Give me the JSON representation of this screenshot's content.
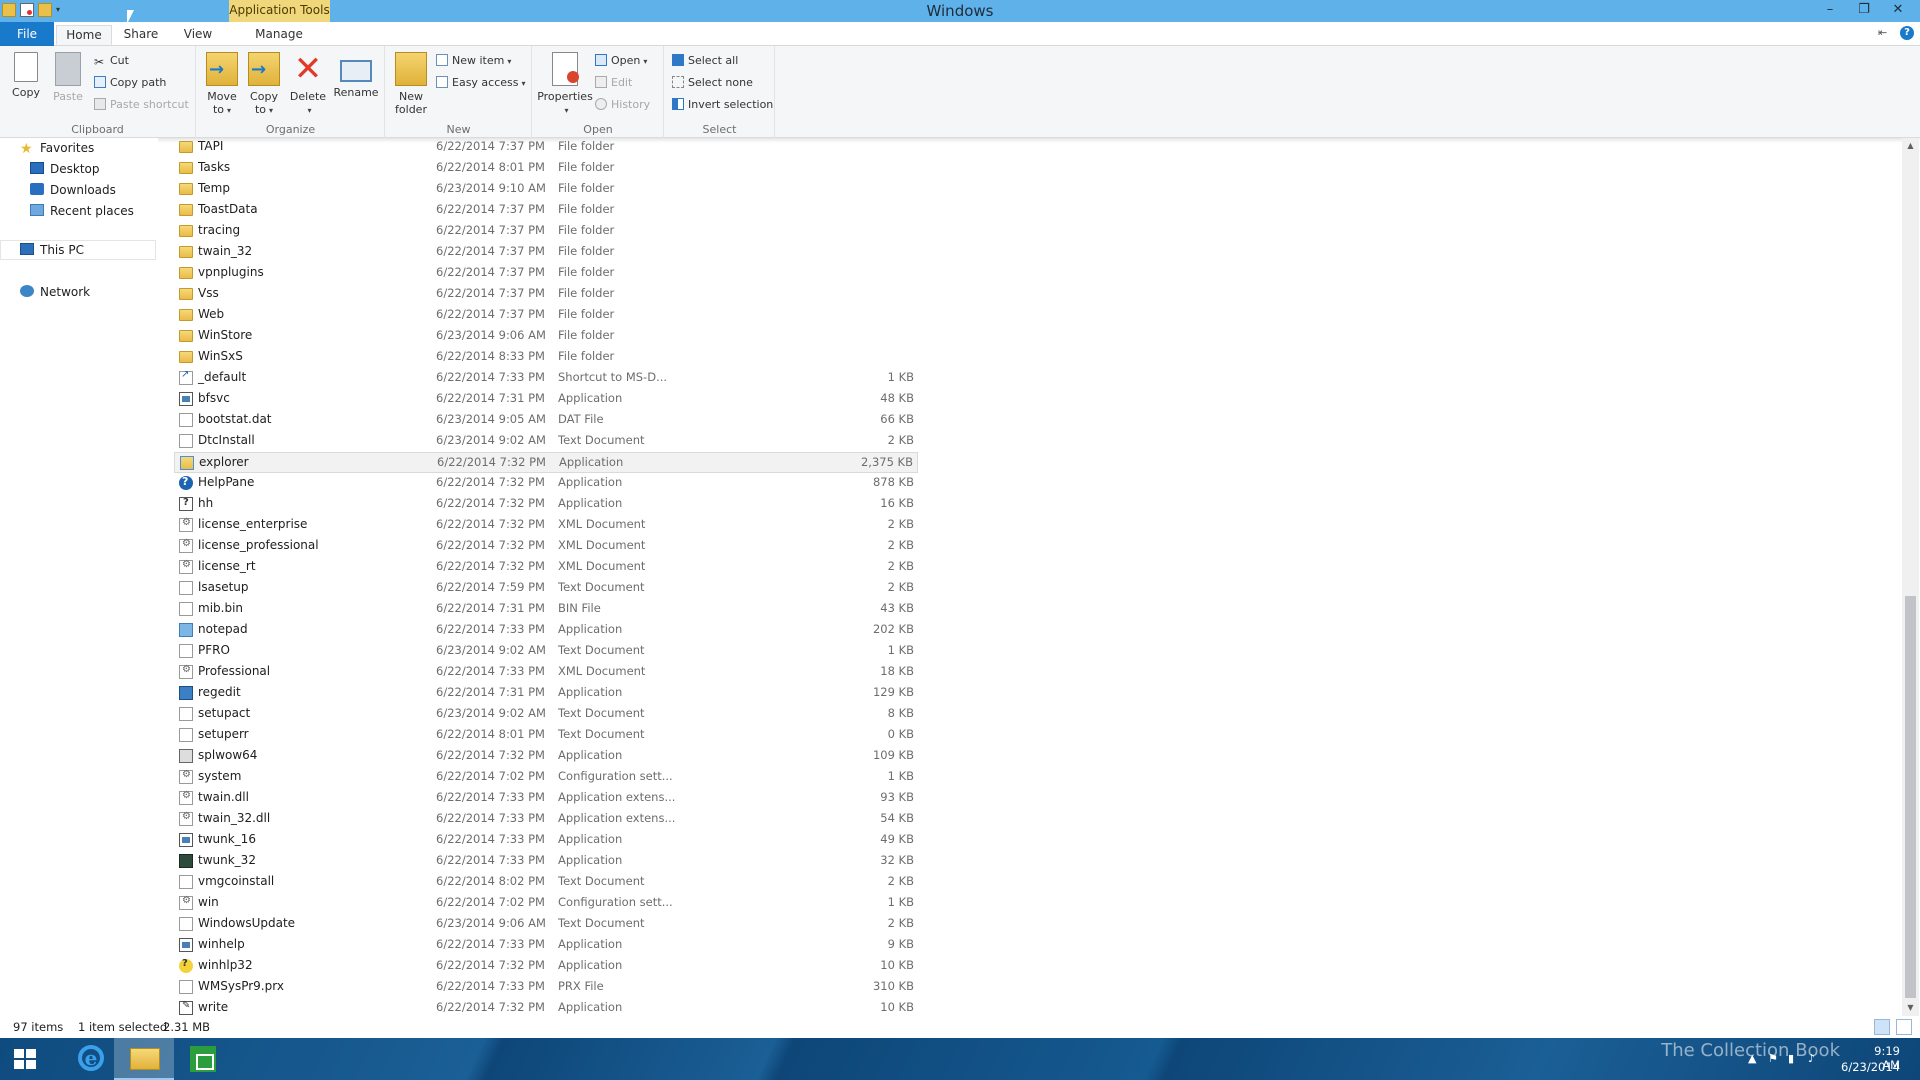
{
  "window": {
    "title": "Windows",
    "contextual_tab": "Application Tools",
    "controls": {
      "minimize": "–",
      "restore": "❐",
      "close": "✕"
    }
  },
  "ribbon_tabs": {
    "file": "File",
    "home": "Home",
    "share": "Share",
    "view": "View",
    "manage": "Manage"
  },
  "ribbon": {
    "clipboard": {
      "label": "Clipboard",
      "copy": "Copy",
      "paste": "Paste",
      "cut": "Cut",
      "copy_path": "Copy path",
      "paste_shortcut": "Paste shortcut"
    },
    "organize": {
      "label": "Organize",
      "move_to_line1": "Move",
      "move_to_line2": "to",
      "copy_to_line1": "Copy",
      "copy_to_line2": "to",
      "delete": "Delete",
      "rename": "Rename"
    },
    "new": {
      "label": "New",
      "new_folder_line1": "New",
      "new_folder_line2": "folder",
      "new_item": "New item",
      "easy_access": "Easy access"
    },
    "open": {
      "label": "Open",
      "properties": "Properties",
      "open": "Open",
      "edit": "Edit",
      "history": "History"
    },
    "select": {
      "label": "Select",
      "select_all": "Select all",
      "select_none": "Select none",
      "invert_selection": "Invert selection"
    }
  },
  "nav": {
    "favorites": "Favorites",
    "desktop": "Desktop",
    "downloads": "Downloads",
    "recent_places": "Recent places",
    "this_pc": "This PC",
    "network": "Network"
  },
  "files": [
    {
      "name": "TAPI",
      "date": "6/22/2014 7:37 PM",
      "type": "File folder",
      "size": "",
      "icon": "folder"
    },
    {
      "name": "Tasks",
      "date": "6/22/2014 8:01 PM",
      "type": "File folder",
      "size": "",
      "icon": "folder"
    },
    {
      "name": "Temp",
      "date": "6/23/2014 9:10 AM",
      "type": "File folder",
      "size": "",
      "icon": "folder"
    },
    {
      "name": "ToastData",
      "date": "6/22/2014 7:37 PM",
      "type": "File folder",
      "size": "",
      "icon": "folder"
    },
    {
      "name": "tracing",
      "date": "6/22/2014 7:37 PM",
      "type": "File folder",
      "size": "",
      "icon": "folder"
    },
    {
      "name": "twain_32",
      "date": "6/22/2014 7:37 PM",
      "type": "File folder",
      "size": "",
      "icon": "folder"
    },
    {
      "name": "vpnplugins",
      "date": "6/22/2014 7:37 PM",
      "type": "File folder",
      "size": "",
      "icon": "folder"
    },
    {
      "name": "Vss",
      "date": "6/22/2014 7:37 PM",
      "type": "File folder",
      "size": "",
      "icon": "folder"
    },
    {
      "name": "Web",
      "date": "6/22/2014 7:37 PM",
      "type": "File folder",
      "size": "",
      "icon": "folder"
    },
    {
      "name": "WinStore",
      "date": "6/23/2014 9:06 AM",
      "type": "File folder",
      "size": "",
      "icon": "folder"
    },
    {
      "name": "WinSxS",
      "date": "6/22/2014 8:33 PM",
      "type": "File folder",
      "size": "",
      "icon": "folder"
    },
    {
      "name": "_default",
      "date": "6/22/2014 7:33 PM",
      "type": "Shortcut to MS-D...",
      "size": "1 KB",
      "icon": "shortcut"
    },
    {
      "name": "bfsvc",
      "date": "6/22/2014 7:31 PM",
      "type": "Application",
      "size": "48 KB",
      "icon": "app"
    },
    {
      "name": "bootstat.dat",
      "date": "6/23/2014 9:05 AM",
      "type": "DAT File",
      "size": "66 KB",
      "icon": "doc"
    },
    {
      "name": "DtcInstall",
      "date": "6/23/2014 9:02 AM",
      "type": "Text Document",
      "size": "2 KB",
      "icon": "doc"
    },
    {
      "name": "explorer",
      "date": "6/22/2014 7:32 PM",
      "type": "Application",
      "size": "2,375 KB",
      "icon": "explorer",
      "selected": true
    },
    {
      "name": "HelpPane",
      "date": "6/22/2014 7:32 PM",
      "type": "Application",
      "size": "878 KB",
      "icon": "help"
    },
    {
      "name": "hh",
      "date": "6/22/2014 7:32 PM",
      "type": "Application",
      "size": "16 KB",
      "icon": "hh"
    },
    {
      "name": "license_enterprise",
      "date": "6/22/2014 7:32 PM",
      "type": "XML Document",
      "size": "2 KB",
      "icon": "config"
    },
    {
      "name": "license_professional",
      "date": "6/22/2014 7:32 PM",
      "type": "XML Document",
      "size": "2 KB",
      "icon": "config"
    },
    {
      "name": "license_rt",
      "date": "6/22/2014 7:32 PM",
      "type": "XML Document",
      "size": "2 KB",
      "icon": "config"
    },
    {
      "name": "lsasetup",
      "date": "6/22/2014 7:59 PM",
      "type": "Text Document",
      "size": "2 KB",
      "icon": "doc"
    },
    {
      "name": "mib.bin",
      "date": "6/22/2014 7:31 PM",
      "type": "BIN File",
      "size": "43 KB",
      "icon": "doc"
    },
    {
      "name": "notepad",
      "date": "6/22/2014 7:33 PM",
      "type": "Application",
      "size": "202 KB",
      "icon": "notepad"
    },
    {
      "name": "PFRO",
      "date": "6/23/2014 9:02 AM",
      "type": "Text Document",
      "size": "1 KB",
      "icon": "doc"
    },
    {
      "name": "Professional",
      "date": "6/22/2014 7:33 PM",
      "type": "XML Document",
      "size": "18 KB",
      "icon": "config"
    },
    {
      "name": "regedit",
      "date": "6/22/2014 7:31 PM",
      "type": "Application",
      "size": "129 KB",
      "icon": "regedit"
    },
    {
      "name": "setupact",
      "date": "6/23/2014 9:02 AM",
      "type": "Text Document",
      "size": "8 KB",
      "icon": "doc"
    },
    {
      "name": "setuperr",
      "date": "6/22/2014 8:01 PM",
      "type": "Text Document",
      "size": "0 KB",
      "icon": "doc"
    },
    {
      "name": "splwow64",
      "date": "6/22/2014 7:32 PM",
      "type": "Application",
      "size": "109 KB",
      "icon": "printer"
    },
    {
      "name": "system",
      "date": "6/22/2014 7:02 PM",
      "type": "Configuration sett...",
      "size": "1 KB",
      "icon": "config"
    },
    {
      "name": "twain.dll",
      "date": "6/22/2014 7:33 PM",
      "type": "Application extens...",
      "size": "93 KB",
      "icon": "config"
    },
    {
      "name": "twain_32.dll",
      "date": "6/22/2014 7:33 PM",
      "type": "Application extens...",
      "size": "54 KB",
      "icon": "config"
    },
    {
      "name": "twunk_16",
      "date": "6/22/2014 7:33 PM",
      "type": "Application",
      "size": "49 KB",
      "icon": "app"
    },
    {
      "name": "twunk_32",
      "date": "6/22/2014 7:33 PM",
      "type": "Application",
      "size": "32 KB",
      "icon": "dark"
    },
    {
      "name": "vmgcoinstall",
      "date": "6/22/2014 8:02 PM",
      "type": "Text Document",
      "size": "2 KB",
      "icon": "doc"
    },
    {
      "name": "win",
      "date": "6/22/2014 7:02 PM",
      "type": "Configuration sett...",
      "size": "1 KB",
      "icon": "config"
    },
    {
      "name": "WindowsUpdate",
      "date": "6/23/2014 9:06 AM",
      "type": "Text Document",
      "size": "2 KB",
      "icon": "doc"
    },
    {
      "name": "winhelp",
      "date": "6/22/2014 7:33 PM",
      "type": "Application",
      "size": "9 KB",
      "icon": "app"
    },
    {
      "name": "winhlp32",
      "date": "6/22/2014 7:32 PM",
      "type": "Application",
      "size": "10 KB",
      "icon": "winhlp"
    },
    {
      "name": "WMSysPr9.prx",
      "date": "6/22/2014 7:33 PM",
      "type": "PRX File",
      "size": "310 KB",
      "icon": "doc"
    },
    {
      "name": "write",
      "date": "6/22/2014 7:32 PM",
      "type": "Application",
      "size": "10 KB",
      "icon": "write"
    }
  ],
  "status": {
    "item_count": "97 items",
    "selection": "1 item selected",
    "selection_size": "2.31 MB"
  },
  "taskbar": {
    "watermark": "The Collection Book",
    "time": "9:19 AM",
    "date": "6/23/2014"
  },
  "colors": {
    "titlebar": "#5fb1e9",
    "file_tab": "#1979ca",
    "contextual_tab": "#f1d77c",
    "taskbar": "#0f4b7e"
  }
}
